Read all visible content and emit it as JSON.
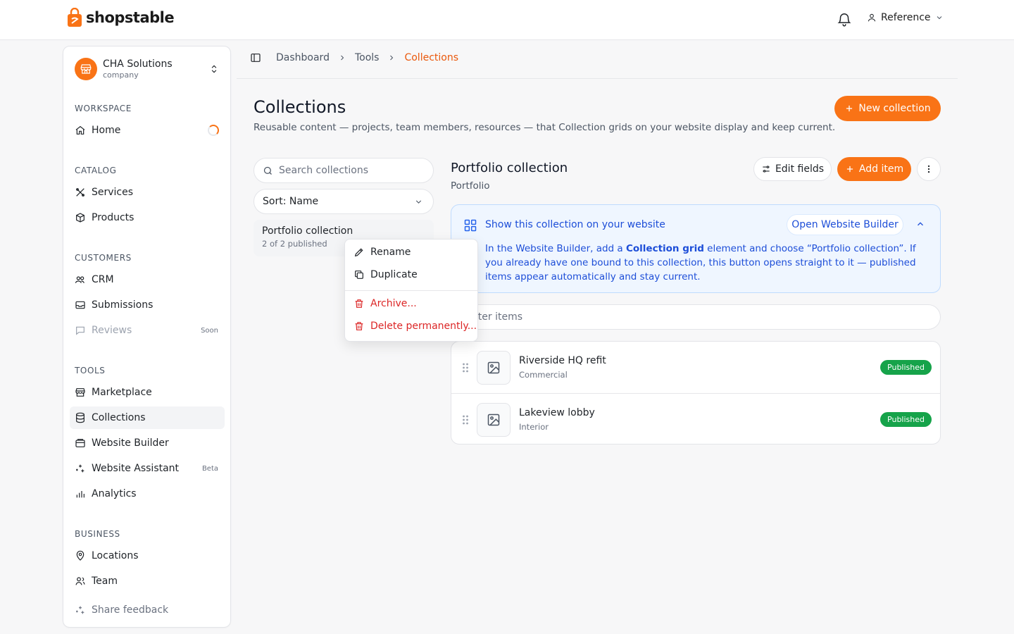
{
  "brand": {
    "name": "shopstable",
    "accent": "#f97316"
  },
  "header": {
    "user_label": "Reference"
  },
  "workspace": {
    "name": "CHA Solutions",
    "type": "company"
  },
  "sidebar": {
    "sections": [
      {
        "label": "WORKSPACE",
        "items": [
          {
            "label": "Home",
            "icon": "home-icon"
          }
        ]
      },
      {
        "label": "CATALOG",
        "items": [
          {
            "label": "Services",
            "icon": "tools-icon"
          },
          {
            "label": "Products",
            "icon": "box-icon"
          }
        ]
      },
      {
        "label": "CUSTOMERS",
        "items": [
          {
            "label": "CRM",
            "icon": "users-icon"
          },
          {
            "label": "Submissions",
            "icon": "inbox-icon"
          },
          {
            "label": "Reviews",
            "icon": "message-icon",
            "tag": "Soon"
          }
        ]
      },
      {
        "label": "TOOLS",
        "items": [
          {
            "label": "Marketplace",
            "icon": "store-icon"
          },
          {
            "label": "Collections",
            "icon": "database-icon"
          },
          {
            "label": "Website Builder",
            "icon": "builder-icon"
          },
          {
            "label": "Website Assistant",
            "icon": "sparkles-icon",
            "tag": "Beta"
          },
          {
            "label": "Analytics",
            "icon": "chart-icon"
          }
        ]
      },
      {
        "label": "BUSINESS",
        "items": [
          {
            "label": "Locations",
            "icon": "pin-icon"
          },
          {
            "label": "Team",
            "icon": "team-icon"
          }
        ]
      }
    ],
    "feedback": "Share feedback"
  },
  "breadcrumb": [
    "Dashboard",
    "Tools",
    "Collections"
  ],
  "page": {
    "title": "Collections",
    "subtitle": "Reusable content — projects, team members, resources — that Collection grids on your website display and keep current.",
    "new_button": "New collection"
  },
  "collections_list": {
    "search_placeholder": "Search collections",
    "sort_label": "Sort: Name",
    "items": [
      {
        "name": "Portfolio collection",
        "status": "2 of 2 published"
      }
    ]
  },
  "context_menu": {
    "rename": "Rename",
    "duplicate": "Duplicate",
    "archive": "Archive...",
    "delete": "Delete permanently..."
  },
  "detail": {
    "title": "Portfolio collection",
    "subtitle": "Portfolio",
    "edit_fields": "Edit fields",
    "add_item": "Add item",
    "info": {
      "title": "Show this collection on your website",
      "button": "Open Website Builder",
      "body_prefix": "In the Website Builder, add a ",
      "body_bold": "Collection grid",
      "body_suffix": " element and choose “Portfolio collection”. If you already have one bound to this collection, this button opens straight to it — published items appear automatically and stay current."
    },
    "filter_placeholder": "ilter items",
    "items": [
      {
        "name": "Riverside HQ refit",
        "category": "Commercial",
        "status": "Published"
      },
      {
        "name": "Lakeview lobby",
        "category": "Interior",
        "status": "Published"
      }
    ]
  }
}
